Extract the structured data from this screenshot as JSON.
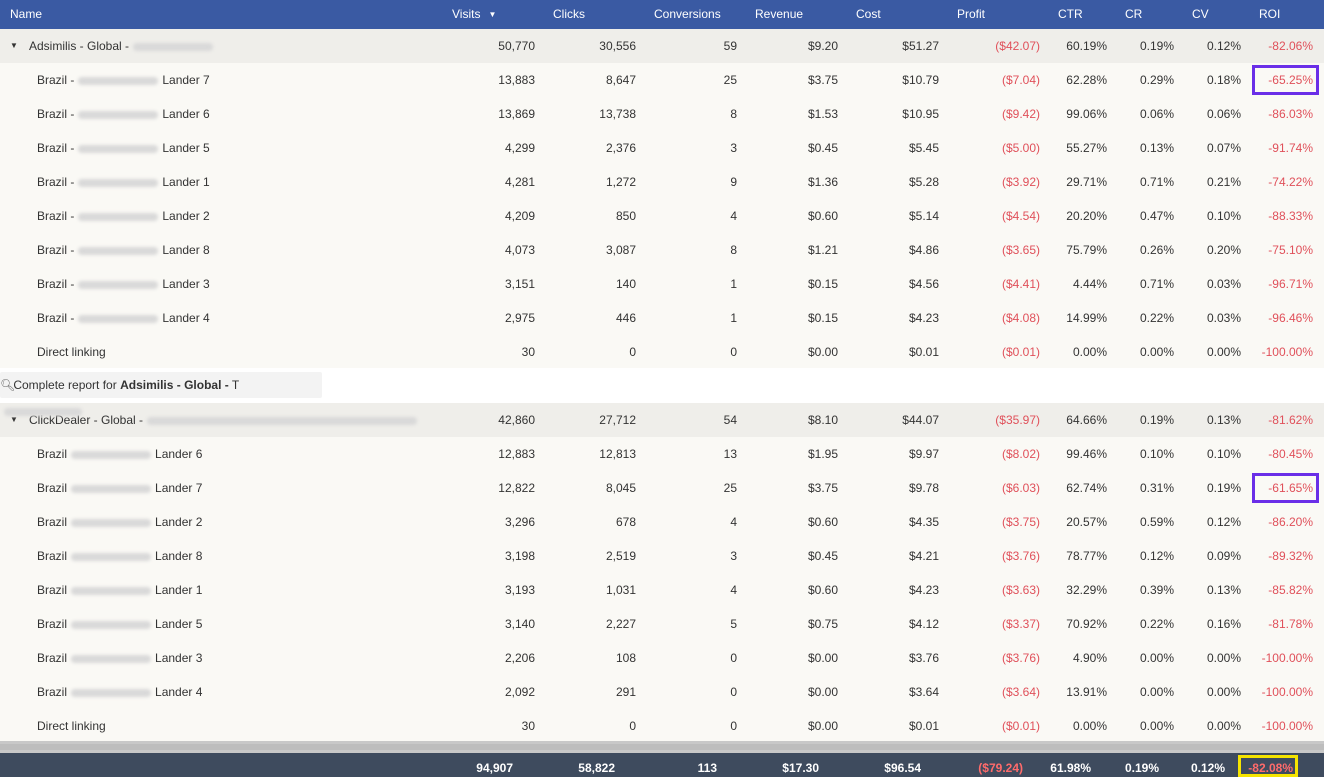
{
  "columns": {
    "name": "Name",
    "visits": "Visits",
    "clicks": "Clicks",
    "conversions": "Conversions",
    "revenue": "Revenue",
    "cost": "Cost",
    "profit": "Profit",
    "ctr": "CTR",
    "cr": "CR",
    "cv": "CV",
    "roi": "ROI",
    "sort_icon": "triangle-down-icon"
  },
  "group1": {
    "name": "Adsimilis - Global -",
    "visits": "50,770",
    "clicks": "30,556",
    "conversions": "59",
    "revenue": "$9.20",
    "cost": "$51.27",
    "profit": "($42.07)",
    "ctr": "60.19%",
    "cr": "0.19%",
    "cv": "0.12%",
    "roi": "-82.06%",
    "rows": [
      {
        "country": "Brazil -",
        "lander": "Lander 7",
        "visits": "13,883",
        "clicks": "8,647",
        "conversions": "25",
        "revenue": "$3.75",
        "cost": "$10.79",
        "profit": "($7.04)",
        "ctr": "62.28%",
        "cr": "0.29%",
        "cv": "0.18%",
        "roi": "-65.25%"
      },
      {
        "country": "Brazil -",
        "lander": "Lander 6",
        "visits": "13,869",
        "clicks": "13,738",
        "conversions": "8",
        "revenue": "$1.53",
        "cost": "$10.95",
        "profit": "($9.42)",
        "ctr": "99.06%",
        "cr": "0.06%",
        "cv": "0.06%",
        "roi": "-86.03%"
      },
      {
        "country": "Brazil -",
        "lander": "Lander 5",
        "visits": "4,299",
        "clicks": "2,376",
        "conversions": "3",
        "revenue": "$0.45",
        "cost": "$5.45",
        "profit": "($5.00)",
        "ctr": "55.27%",
        "cr": "0.13%",
        "cv": "0.07%",
        "roi": "-91.74%"
      },
      {
        "country": "Brazil -",
        "lander": "Lander 1",
        "visits": "4,281",
        "clicks": "1,272",
        "conversions": "9",
        "revenue": "$1.36",
        "cost": "$5.28",
        "profit": "($3.92)",
        "ctr": "29.71%",
        "cr": "0.71%",
        "cv": "0.21%",
        "roi": "-74.22%"
      },
      {
        "country": "Brazil -",
        "lander": "Lander 2",
        "visits": "4,209",
        "clicks": "850",
        "conversions": "4",
        "revenue": "$0.60",
        "cost": "$5.14",
        "profit": "($4.54)",
        "ctr": "20.20%",
        "cr": "0.47%",
        "cv": "0.10%",
        "roi": "-88.33%"
      },
      {
        "country": "Brazil -",
        "lander": "Lander 8",
        "visits": "4,073",
        "clicks": "3,087",
        "conversions": "8",
        "revenue": "$1.21",
        "cost": "$4.86",
        "profit": "($3.65)",
        "ctr": "75.79%",
        "cr": "0.26%",
        "cv": "0.20%",
        "roi": "-75.10%"
      },
      {
        "country": "Brazil -",
        "lander": "Lander 3",
        "visits": "3,151",
        "clicks": "140",
        "conversions": "1",
        "revenue": "$0.15",
        "cost": "$4.56",
        "profit": "($4.41)",
        "ctr": "4.44%",
        "cr": "0.71%",
        "cv": "0.03%",
        "roi": "-96.71%"
      },
      {
        "country": "Brazil -",
        "lander": "Lander 4",
        "visits": "2,975",
        "clicks": "446",
        "conversions": "1",
        "revenue": "$0.15",
        "cost": "$4.23",
        "profit": "($4.08)",
        "ctr": "14.99%",
        "cr": "0.22%",
        "cv": "0.03%",
        "roi": "-96.46%"
      },
      {
        "country": "Direct linking",
        "lander": "",
        "visits": "30",
        "clicks": "0",
        "conversions": "0",
        "revenue": "$0.00",
        "cost": "$0.01",
        "profit": "($0.01)",
        "ctr": "0.00%",
        "cr": "0.00%",
        "cv": "0.00%",
        "roi": "-100.00%"
      }
    ]
  },
  "report_link": {
    "prefix": "Complete report for",
    "bold": "Adsimilis - Global -",
    "suffix": "T"
  },
  "group2": {
    "name": "ClickDealer - Global -",
    "visits": "42,860",
    "clicks": "27,712",
    "conversions": "54",
    "revenue": "$8.10",
    "cost": "$44.07",
    "profit": "($35.97)",
    "ctr": "64.66%",
    "cr": "0.19%",
    "cv": "0.13%",
    "roi": "-81.62%",
    "rows": [
      {
        "country": "Brazil",
        "lander": "Lander 6",
        "visits": "12,883",
        "clicks": "12,813",
        "conversions": "13",
        "revenue": "$1.95",
        "cost": "$9.97",
        "profit": "($8.02)",
        "ctr": "99.46%",
        "cr": "0.10%",
        "cv": "0.10%",
        "roi": "-80.45%"
      },
      {
        "country": "Brazil",
        "lander": "Lander 7",
        "visits": "12,822",
        "clicks": "8,045",
        "conversions": "25",
        "revenue": "$3.75",
        "cost": "$9.78",
        "profit": "($6.03)",
        "ctr": "62.74%",
        "cr": "0.31%",
        "cv": "0.19%",
        "roi": "-61.65%"
      },
      {
        "country": "Brazil",
        "lander": "Lander 2",
        "visits": "3,296",
        "clicks": "678",
        "conversions": "4",
        "revenue": "$0.60",
        "cost": "$4.35",
        "profit": "($3.75)",
        "ctr": "20.57%",
        "cr": "0.59%",
        "cv": "0.12%",
        "roi": "-86.20%"
      },
      {
        "country": "Brazil",
        "lander": "Lander 8",
        "visits": "3,198",
        "clicks": "2,519",
        "conversions": "3",
        "revenue": "$0.45",
        "cost": "$4.21",
        "profit": "($3.76)",
        "ctr": "78.77%",
        "cr": "0.12%",
        "cv": "0.09%",
        "roi": "-89.32%"
      },
      {
        "country": "Brazil",
        "lander": "Lander 1",
        "visits": "3,193",
        "clicks": "1,031",
        "conversions": "4",
        "revenue": "$0.60",
        "cost": "$4.23",
        "profit": "($3.63)",
        "ctr": "32.29%",
        "cr": "0.39%",
        "cv": "0.13%",
        "roi": "-85.82%"
      },
      {
        "country": "Brazil",
        "lander": "Lander 5",
        "visits": "3,140",
        "clicks": "2,227",
        "conversions": "5",
        "revenue": "$0.75",
        "cost": "$4.12",
        "profit": "($3.37)",
        "ctr": "70.92%",
        "cr": "0.22%",
        "cv": "0.16%",
        "roi": "-81.78%"
      },
      {
        "country": "Brazil",
        "lander": "Lander 3",
        "visits": "2,206",
        "clicks": "108",
        "conversions": "0",
        "revenue": "$0.00",
        "cost": "$3.76",
        "profit": "($3.76)",
        "ctr": "4.90%",
        "cr": "0.00%",
        "cv": "0.00%",
        "roi": "-100.00%"
      },
      {
        "country": "Brazil",
        "lander": "Lander 4",
        "visits": "2,092",
        "clicks": "291",
        "conversions": "0",
        "revenue": "$0.00",
        "cost": "$3.64",
        "profit": "($3.64)",
        "ctr": "13.91%",
        "cr": "0.00%",
        "cv": "0.00%",
        "roi": "-100.00%"
      },
      {
        "country": "Direct linking",
        "lander": "",
        "visits": "30",
        "clicks": "0",
        "conversions": "0",
        "revenue": "$0.00",
        "cost": "$0.01",
        "profit": "($0.01)",
        "ctr": "0.00%",
        "cr": "0.00%",
        "cv": "0.00%",
        "roi": "-100.00%"
      }
    ]
  },
  "totals": {
    "visits": "94,907",
    "clicks": "58,822",
    "conversions": "113",
    "revenue": "$17.30",
    "cost": "$96.54",
    "profit": "($79.24)",
    "ctr": "61.98%",
    "cr": "0.19%",
    "cv": "0.12%",
    "roi": "-82.08%"
  },
  "colors": {
    "header_bg": "#3a5aa3",
    "footer_bg": "#3e4b5e",
    "negative": "#e0505a",
    "highlight_purple": "#6a2ee8",
    "highlight_yellow": "#f5e400"
  }
}
